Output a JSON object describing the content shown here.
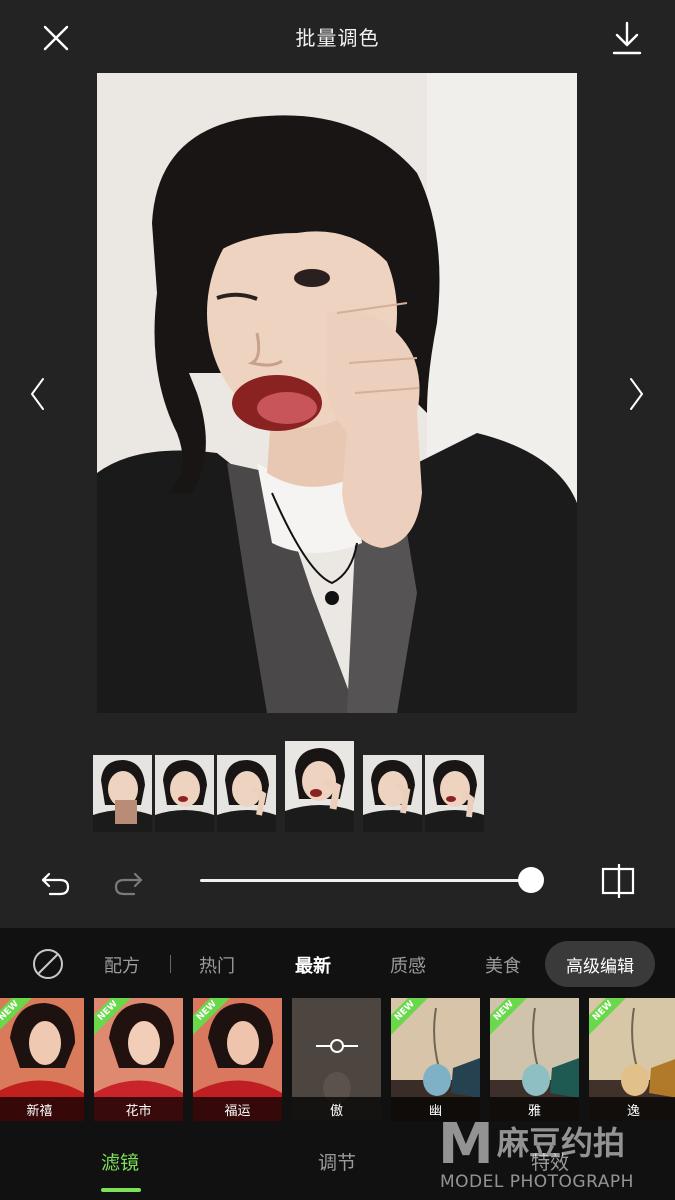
{
  "header": {
    "title": "批量调色",
    "close_icon": "close-icon",
    "download_icon": "download-icon"
  },
  "photo": {
    "prev_icon": "chevron-left-icon",
    "next_icon": "chevron-right-icon"
  },
  "thumbnails": {
    "count": 6,
    "selected_index": 3
  },
  "controls": {
    "undo_icon": "undo-icon",
    "redo_icon": "redo-icon",
    "intensity_fraction": 1.0,
    "compare_icon": "compare-icon"
  },
  "filter_tabs": {
    "none_icon": "none-icon",
    "items": [
      "配方",
      "热门",
      "最新",
      "质感",
      "美食"
    ],
    "active": "最新",
    "advanced_label": "高级编辑"
  },
  "filters": [
    {
      "label": "新禧",
      "new": true
    },
    {
      "label": "花市",
      "new": true
    },
    {
      "label": "福运",
      "new": true
    },
    {
      "label": "傲",
      "new": false,
      "icon": "slider-adjust-icon"
    },
    {
      "label": "幽",
      "new": true
    },
    {
      "label": "雅",
      "new": true
    },
    {
      "label": "逸",
      "new": true
    }
  ],
  "new_badge": "NEW",
  "bottom_tabs": {
    "items": [
      "滤镜",
      "调节",
      "特效"
    ],
    "active": "滤镜"
  },
  "watermark": {
    "logo": "M",
    "brand": "麻豆约拍",
    "tagline": "MODEL PHOTOGRAPH"
  },
  "colors": {
    "background": "#232323",
    "panel": "#111111",
    "accent_green": "#7ee05a",
    "badge_green": "#6ad84b"
  }
}
